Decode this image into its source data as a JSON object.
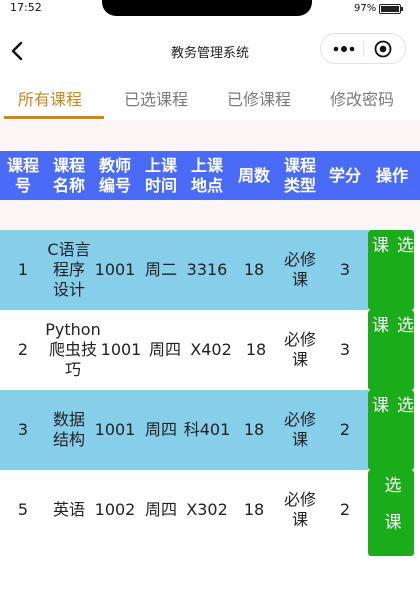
{
  "status": {
    "time": "17:52",
    "battery": "97%"
  },
  "navbar": {
    "title": "教务管理系统"
  },
  "tabs": [
    {
      "label": "所有课程",
      "active": true
    },
    {
      "label": "已选课程",
      "active": false
    },
    {
      "label": "已修课程",
      "active": false
    },
    {
      "label": "修改密码",
      "active": false
    }
  ],
  "table": {
    "headers": [
      "课程号",
      "课程名称",
      "教师编号",
      "上课时间",
      "上课地点",
      "周数",
      "课程类型",
      "学分",
      "操作"
    ],
    "rows": [
      {
        "id": "1",
        "name": "C语言程序设计",
        "teacher": "1001",
        "time": "周二",
        "place": "3316",
        "weeks": "18",
        "type": "必修课",
        "credit": "3",
        "action": "选课"
      },
      {
        "id": "2",
        "name": "Python爬虫技巧",
        "teacher": "1001",
        "time": "周四",
        "place": "X402",
        "weeks": "18",
        "type": "必修课",
        "credit": "3",
        "action": "选课"
      },
      {
        "id": "3",
        "name": "数据结构",
        "teacher": "1001",
        "time": "周四",
        "place": "科401",
        "weeks": "18",
        "type": "必修课",
        "credit": "2",
        "action": "选课"
      },
      {
        "id": "5",
        "name": "英语",
        "teacher": "1002",
        "time": "周四",
        "place": "X302",
        "weeks": "18",
        "type": "必修课",
        "credit": "2",
        "action": "选课"
      }
    ]
  },
  "colors": {
    "accent": "#c8862b",
    "header": "#4a6bf7",
    "row_alt": "#87ceea",
    "button": "#1aad19"
  }
}
